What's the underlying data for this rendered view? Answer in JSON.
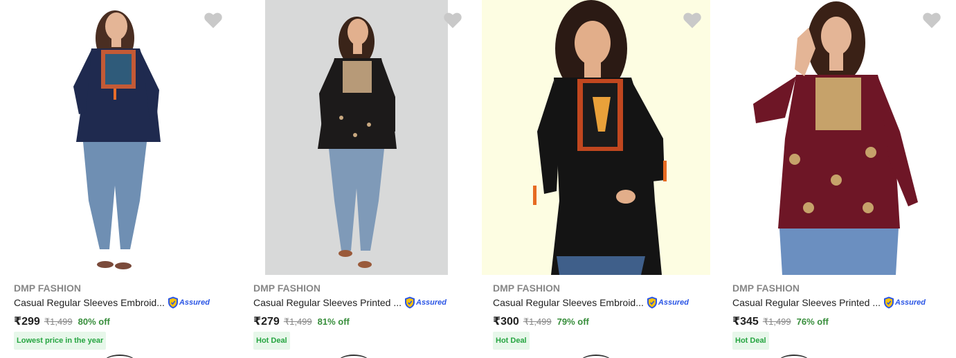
{
  "colors": {
    "price": "#212121",
    "mrp": "#878787",
    "discount": "#388e3c",
    "badge_bg": "#e7f7ea",
    "badge_text": "#26a541",
    "assured_blue": "#2a55e5",
    "wishlist_heart": "#c9c9c9"
  },
  "products": [
    {
      "brand": "DMP FASHION",
      "title": "Casual Regular Sleeves Embroid...",
      "assured": "Assured",
      "price": "₹299",
      "mrp": "₹1,499",
      "discount": "80% off",
      "badge": "Lowest price in the year",
      "image_background": "#ffffff",
      "top_color": "#1f2a4f"
    },
    {
      "brand": "DMP FASHION",
      "title": "Casual Regular Sleeves Printed ...",
      "assured": "Assured",
      "price": "₹279",
      "mrp": "₹1,499",
      "discount": "81% off",
      "badge": "Hot Deal",
      "image_background": "#d8d9d9",
      "top_color": "#1c1a1a"
    },
    {
      "brand": "DMP FASHION",
      "title": "Casual Regular Sleeves Embroid...",
      "assured": "Assured",
      "price": "₹300",
      "mrp": "₹1,499",
      "discount": "79% off",
      "badge": "Hot Deal",
      "image_background": "#fdfde2",
      "top_color": "#141414"
    },
    {
      "brand": "DMP FASHION",
      "title": "Casual Regular Sleeves Printed ...",
      "assured": "Assured",
      "price": "₹345",
      "mrp": "₹1,499",
      "discount": "76% off",
      "badge": "Hot Deal",
      "image_background": "#ffffff",
      "top_color": "#6e1626"
    }
  ]
}
